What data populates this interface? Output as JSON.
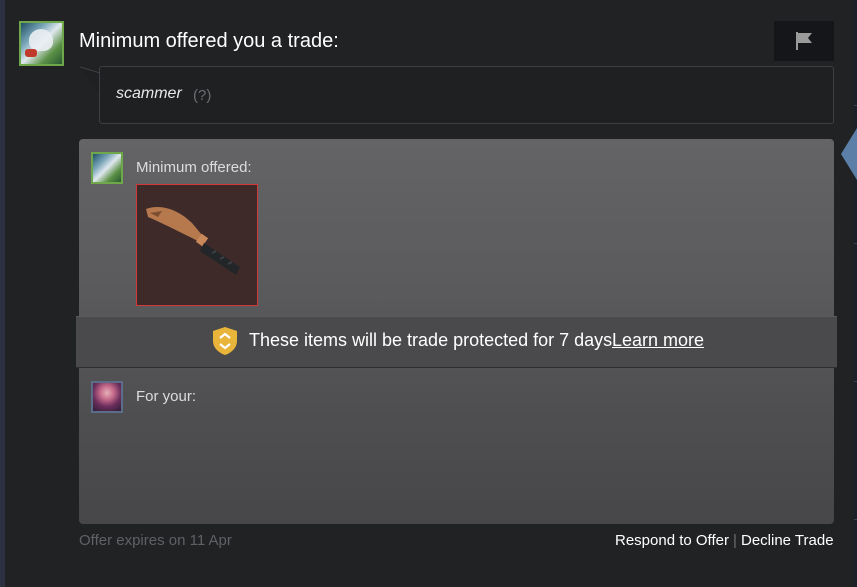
{
  "header": {
    "title": "Minimum offered you a trade:"
  },
  "message": {
    "text": "scammer",
    "help": "(?)"
  },
  "offer": {
    "sender_label": "Minimum offered:",
    "item_icon": "knife-icon",
    "item_border_color": "#d2383a",
    "protection_text": "These items will be trade protected for 7 days.",
    "learn_more": "Learn more",
    "protection_icon": "shield-icon",
    "receiver_label": "For your:"
  },
  "footer": {
    "expires": "Offer expires on 11 Apr",
    "respond": "Respond to Offer",
    "separator": "|",
    "decline": "Decline Trade"
  }
}
